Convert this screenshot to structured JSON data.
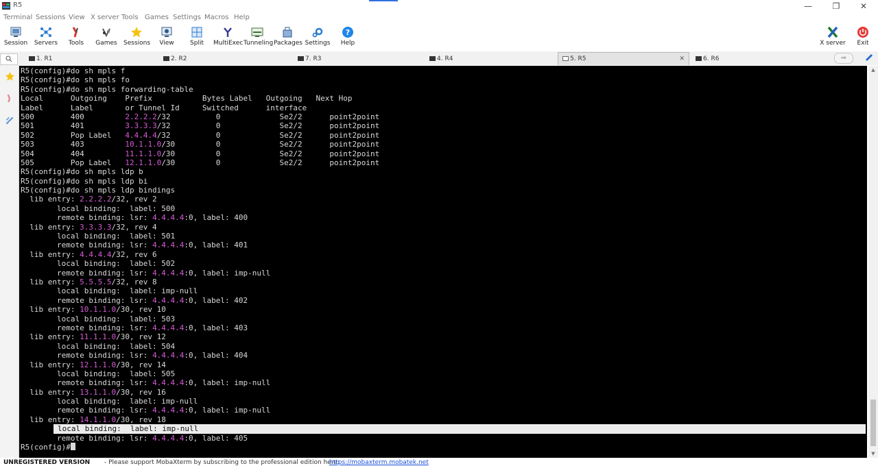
{
  "window": {
    "title": "R5",
    "minimize": "—",
    "maximize": "❐",
    "close": "✕"
  },
  "menu": [
    "Terminal",
    "Sessions",
    "View",
    "X server",
    "Tools",
    "Games",
    "Settings",
    "Macros",
    "Help"
  ],
  "toolbar": {
    "items": [
      {
        "label": "Session",
        "icon": "session-icon"
      },
      {
        "label": "Servers",
        "icon": "servers-icon"
      },
      {
        "label": "Tools",
        "icon": "tools-icon"
      },
      {
        "label": "Games",
        "icon": "games-icon"
      },
      {
        "label": "Sessions",
        "icon": "star-icon"
      },
      {
        "label": "View",
        "icon": "view-icon"
      },
      {
        "label": "Split",
        "icon": "split-icon"
      },
      {
        "label": "MultiExec",
        "icon": "multiexec-icon"
      },
      {
        "label": "Tunneling",
        "icon": "tunneling-icon"
      },
      {
        "label": "Packages",
        "icon": "packages-icon"
      },
      {
        "label": "Settings",
        "icon": "gear-icon"
      },
      {
        "label": "Help",
        "icon": "help-icon"
      }
    ],
    "right": [
      {
        "label": "X server",
        "icon": "x-server-icon"
      },
      {
        "label": "Exit",
        "icon": "power-icon"
      }
    ]
  },
  "tabs": [
    {
      "label": "1. R1",
      "active": false
    },
    {
      "label": "2. R2",
      "active": false
    },
    {
      "label": "7. R3",
      "active": false
    },
    {
      "label": "4. R4",
      "active": false
    },
    {
      "label": "5. R5",
      "active": true
    },
    {
      "label": "6. R6",
      "active": false
    }
  ],
  "tab_close": "✕",
  "tab_nav": "⇨",
  "terminal": {
    "lines": [
      [
        {
          "t": "R5(config)#do sh mpls f"
        }
      ],
      [
        {
          "t": "R5(config)#do sh mpls fo"
        }
      ],
      [
        {
          "t": "R5(config)#do sh mpls forwarding-table"
        }
      ],
      [
        {
          "t": "Local      Outgoing    Prefix           Bytes Label   Outgoing   Next Hop"
        }
      ],
      [
        {
          "t": "Label      Label       or Tunnel Id     Switched      interface"
        }
      ],
      [
        {
          "t": "500        400         "
        },
        {
          "t": "2.2.2.2",
          "ip": true
        },
        {
          "t": "/32          0             Se2/2      point2point"
        }
      ],
      [
        {
          "t": "501        401         "
        },
        {
          "t": "3.3.3.3",
          "ip": true
        },
        {
          "t": "/32          0             Se2/2      point2point"
        }
      ],
      [
        {
          "t": "502        Pop Label   "
        },
        {
          "t": "4.4.4.4",
          "ip": true
        },
        {
          "t": "/32          0             Se2/2      point2point"
        }
      ],
      [
        {
          "t": "503        403         "
        },
        {
          "t": "10.1.1.0",
          "ip": true
        },
        {
          "t": "/30         0             Se2/2      point2point"
        }
      ],
      [
        {
          "t": "504        404         "
        },
        {
          "t": "11.1.1.0",
          "ip": true
        },
        {
          "t": "/30         0             Se2/2      point2point"
        }
      ],
      [
        {
          "t": "505        Pop Label   "
        },
        {
          "t": "12.1.1.0",
          "ip": true
        },
        {
          "t": "/30         0             Se2/2      point2point"
        }
      ],
      [
        {
          "t": "R5(config)#do sh mpls ldp b"
        }
      ],
      [
        {
          "t": "R5(config)#do sh mpls ldp bi"
        }
      ],
      [
        {
          "t": "R5(config)#do sh mpls ldp bindings"
        }
      ],
      [
        {
          "t": "  lib entry: "
        },
        {
          "t": "2.2.2.2",
          "ip": true
        },
        {
          "t": "/32, rev 2"
        }
      ],
      [
        {
          "t": "        local binding:  label: 500"
        }
      ],
      [
        {
          "t": "        remote binding: lsr: "
        },
        {
          "t": "4.4.4.4",
          "ip": true
        },
        {
          "t": ":0, label: 400"
        }
      ],
      [
        {
          "t": "  lib entry: "
        },
        {
          "t": "3.3.3.3",
          "ip": true
        },
        {
          "t": "/32, rev 4"
        }
      ],
      [
        {
          "t": "        local binding:  label: 501"
        }
      ],
      [
        {
          "t": "        remote binding: lsr: "
        },
        {
          "t": "4.4.4.4",
          "ip": true
        },
        {
          "t": ":0, label: 401"
        }
      ],
      [
        {
          "t": "  lib entry: "
        },
        {
          "t": "4.4.4.4",
          "ip": true
        },
        {
          "t": "/32, rev 6"
        }
      ],
      [
        {
          "t": "        local binding:  label: 502"
        }
      ],
      [
        {
          "t": "        remote binding: lsr: "
        },
        {
          "t": "4.4.4.4",
          "ip": true
        },
        {
          "t": ":0, label: imp-null"
        }
      ],
      [
        {
          "t": "  lib entry: "
        },
        {
          "t": "5.5.5.5",
          "ip": true
        },
        {
          "t": "/32, rev 8"
        }
      ],
      [
        {
          "t": "        local binding:  label: imp-null"
        }
      ],
      [
        {
          "t": "        remote binding: lsr: "
        },
        {
          "t": "4.4.4.4",
          "ip": true
        },
        {
          "t": ":0, label: 402"
        }
      ],
      [
        {
          "t": "  lib entry: "
        },
        {
          "t": "10.1.1.0",
          "ip": true
        },
        {
          "t": "/30, rev 10"
        }
      ],
      [
        {
          "t": "        local binding:  label: 503"
        }
      ],
      [
        {
          "t": "        remote binding: lsr: "
        },
        {
          "t": "4.4.4.4",
          "ip": true
        },
        {
          "t": ":0, label: 403"
        }
      ],
      [
        {
          "t": "  lib entry: "
        },
        {
          "t": "11.1.1.0",
          "ip": true
        },
        {
          "t": "/30, rev 12"
        }
      ],
      [
        {
          "t": "        local binding:  label: 504"
        }
      ],
      [
        {
          "t": "        remote binding: lsr: "
        },
        {
          "t": "4.4.4.4",
          "ip": true
        },
        {
          "t": ":0, label: 404"
        }
      ],
      [
        {
          "t": "  lib entry: "
        },
        {
          "t": "12.1.1.0",
          "ip": true
        },
        {
          "t": "/30, rev 14"
        }
      ],
      [
        {
          "t": "        local binding:  label: 505"
        }
      ],
      [
        {
          "t": "        remote binding: lsr: "
        },
        {
          "t": "4.4.4.4",
          "ip": true
        },
        {
          "t": ":0, label: imp-null"
        }
      ],
      [
        {
          "t": "  lib entry: "
        },
        {
          "t": "13.1.1.0",
          "ip": true
        },
        {
          "t": "/30, rev 16"
        }
      ],
      [
        {
          "t": "        local binding:  label: imp-null"
        }
      ],
      [
        {
          "t": "        remote binding: lsr: "
        },
        {
          "t": "4.4.4.4",
          "ip": true
        },
        {
          "t": ":0, label: imp-null"
        }
      ],
      [
        {
          "t": "  lib entry: "
        },
        {
          "t": "14.1.1.0",
          "ip": true
        },
        {
          "t": "/30, rev 18"
        }
      ],
      [
        {
          "t": "local binding:  label: imp-null",
          "highlight": true
        }
      ],
      [
        {
          "t": "        remote binding: lsr: "
        },
        {
          "t": "4.4.4.4",
          "ip": true
        },
        {
          "t": ":0, label: 405"
        }
      ],
      [
        {
          "t": "R5(config)#"
        },
        {
          "cursor": true
        }
      ]
    ]
  },
  "status": {
    "unregistered": "UNREGISTERED VERSION",
    "message": "-  Please support MobaXterm by subscribing to the professional edition here:",
    "link": "https://mobaxterm.mobatek.net"
  },
  "colors": {
    "ip": "#d65bd6",
    "terminal_bg": "#000000",
    "terminal_fg": "#d9d9d9",
    "link": "#1a4fd6"
  }
}
